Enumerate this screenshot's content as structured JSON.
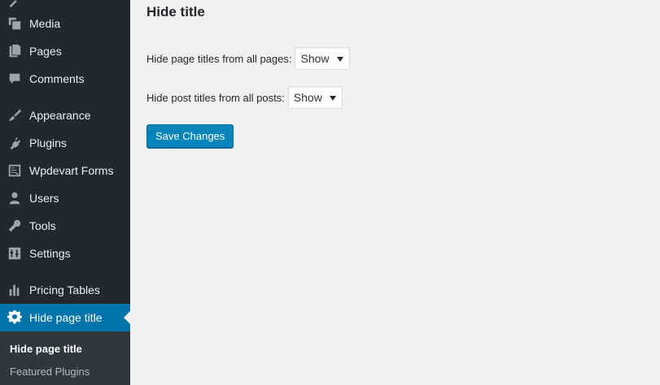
{
  "sidebar": {
    "items": [
      {
        "label": "",
        "icon": "tool-icon"
      },
      {
        "label": "Media",
        "icon": "media-icon"
      },
      {
        "label": "Pages",
        "icon": "pages-icon"
      },
      {
        "label": "Comments",
        "icon": "comments-icon"
      },
      {
        "label": "Appearance",
        "icon": "paintbrush-icon"
      },
      {
        "label": "Plugins",
        "icon": "plug-icon"
      },
      {
        "label": "Wpdevart Forms",
        "icon": "form-icon"
      },
      {
        "label": "Users",
        "icon": "user-icon"
      },
      {
        "label": "Tools",
        "icon": "wrench-icon"
      },
      {
        "label": "Settings",
        "icon": "settings-icon"
      },
      {
        "label": "Pricing Tables",
        "icon": "bar-chart-icon"
      },
      {
        "label": "Hide page title",
        "icon": "gear-icon",
        "current": true
      }
    ],
    "submenu": [
      {
        "label": "Hide page title",
        "active": true
      },
      {
        "label": "Featured Plugins",
        "active": false
      }
    ]
  },
  "main": {
    "title": "Hide title",
    "fields": [
      {
        "label": "Hide page titles from all pages:",
        "value": "Show"
      },
      {
        "label": "Hide post titles from all posts:",
        "value": "Show"
      }
    ],
    "save_label": "Save Changes"
  },
  "colors": {
    "sidebar_bg": "#23282d",
    "current_menu_bg": "#0073aa",
    "button_bg": "#0085ba",
    "page_bg": "#f1f1f1"
  }
}
